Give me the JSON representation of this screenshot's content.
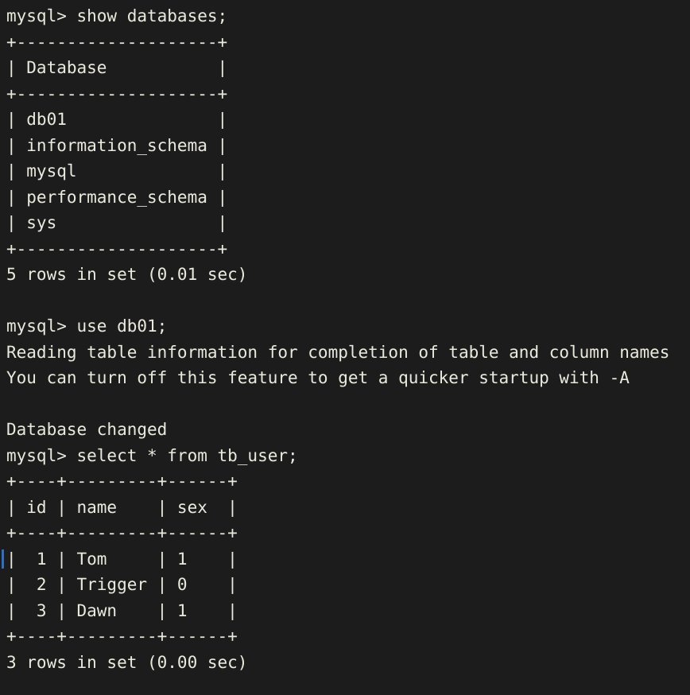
{
  "terminal": {
    "background_color": "#1c1c1c",
    "text_color": "#e9e9dd",
    "cursor_color": "#2f6fbd",
    "prompt": "mysql>",
    "lines": [
      {
        "id": "cmd-show-databases",
        "text": "mysql> show databases;"
      },
      {
        "id": "db-table-top-border",
        "text": "+--------------------+"
      },
      {
        "id": "db-table-header",
        "text": "| Database           |"
      },
      {
        "id": "db-table-header-border",
        "text": "+--------------------+"
      },
      {
        "id": "db-row-db01",
        "text": "| db01               |"
      },
      {
        "id": "db-row-information-schema",
        "text": "| information_schema |"
      },
      {
        "id": "db-row-mysql",
        "text": "| mysql              |"
      },
      {
        "id": "db-row-performance-schema",
        "text": "| performance_schema |"
      },
      {
        "id": "db-row-sys",
        "text": "| sys                |"
      },
      {
        "id": "db-table-bottom-border",
        "text": "+--------------------+"
      },
      {
        "id": "db-result-count",
        "text": "5 rows in set (0.01 sec)"
      },
      {
        "id": "blank-1",
        "text": ""
      },
      {
        "id": "cmd-use-db01",
        "text": "mysql> use db01;"
      },
      {
        "id": "msg-reading-table-info",
        "text": "Reading table information for completion of table and column names"
      },
      {
        "id": "msg-turn-off-feature",
        "text": "You can turn off this feature to get a quicker startup with -A"
      },
      {
        "id": "blank-2",
        "text": ""
      },
      {
        "id": "msg-database-changed",
        "text": "Database changed"
      },
      {
        "id": "cmd-select-tb-user",
        "text": "mysql> select * from tb_user;"
      },
      {
        "id": "user-table-top-border",
        "text": "+----+---------+------+"
      },
      {
        "id": "user-table-header",
        "text": "| id | name    | sex  |"
      },
      {
        "id": "user-table-header-border",
        "text": "+----+---------+------+"
      },
      {
        "id": "user-row-1",
        "text": "|  1 | Tom     | 1    |",
        "cursor": true
      },
      {
        "id": "user-row-2",
        "text": "|  2 | Trigger | 0    |"
      },
      {
        "id": "user-row-3",
        "text": "|  3 | Dawn    | 1    |"
      },
      {
        "id": "user-table-bottom-border",
        "text": "+----+---------+------+"
      },
      {
        "id": "user-result-count",
        "text": "3 rows in set (0.00 sec)"
      }
    ]
  },
  "queries": {
    "show_databases": {
      "statement": "show databases;",
      "columns": [
        "Database"
      ],
      "rows": [
        [
          "db01"
        ],
        [
          "information_schema"
        ],
        [
          "mysql"
        ],
        [
          "performance_schema"
        ],
        [
          "sys"
        ]
      ],
      "row_count": 5,
      "duration_sec": "0.01",
      "result_text": "5 rows in set (0.01 sec)"
    },
    "use_database": {
      "statement": "use db01;",
      "database": "db01",
      "messages": [
        "Reading table information for completion of table and column names",
        "You can turn off this feature to get a quicker startup with -A",
        "Database changed"
      ]
    },
    "select_tb_user": {
      "statement": "select * from tb_user;",
      "table": "tb_user",
      "columns": [
        "id",
        "name",
        "sex"
      ],
      "rows": [
        [
          "1",
          "Tom",
          "1"
        ],
        [
          "2",
          "Trigger",
          "0"
        ],
        [
          "3",
          "Dawn",
          "1"
        ]
      ],
      "row_count": 3,
      "duration_sec": "0.00",
      "result_text": "3 rows in set (0.00 sec)"
    }
  }
}
